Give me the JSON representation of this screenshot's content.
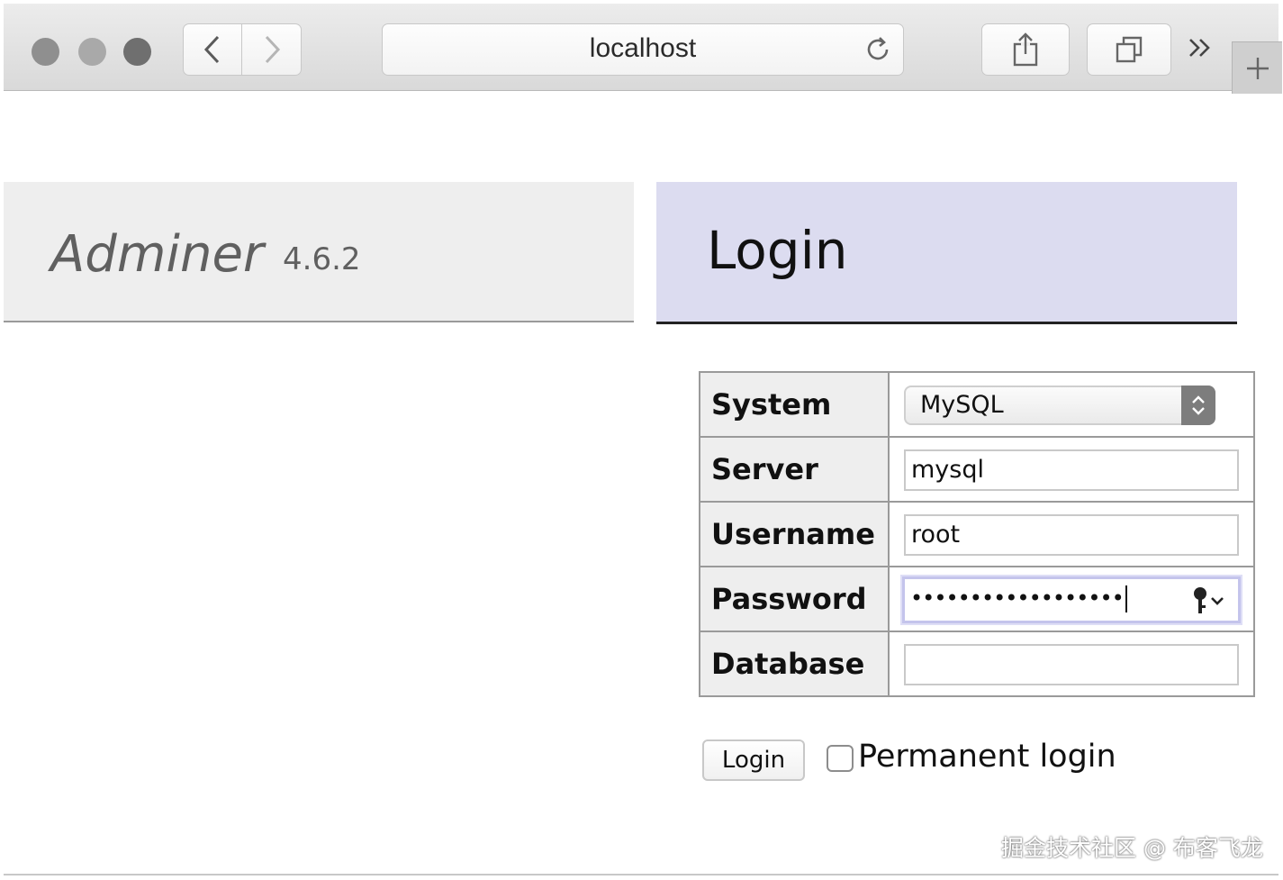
{
  "browser": {
    "url": "localhost",
    "window_dots": [
      "close",
      "minimize",
      "zoom"
    ],
    "icons": {
      "back": "chevron-left-icon",
      "forward": "chevron-right-icon",
      "reload": "reload-icon",
      "share": "share-icon",
      "tabs": "tab-overview-icon",
      "more": "double-chevron-right-icon",
      "new_tab": "plus-icon"
    },
    "more_label": "»",
    "new_tab_label": "+"
  },
  "header": {
    "brand": "Adminer",
    "version": "4.6.2",
    "title": "Login"
  },
  "form": {
    "fields": [
      {
        "label": "System",
        "type": "select",
        "value": "MySQL"
      },
      {
        "label": "Server",
        "type": "text",
        "value": "mysql"
      },
      {
        "label": "Username",
        "type": "text",
        "value": "root"
      },
      {
        "label": "Password",
        "type": "password",
        "value": "••••••••••••••••••"
      },
      {
        "label": "Database",
        "type": "text",
        "value": ""
      }
    ],
    "submit_label": "Login",
    "permanent_label": "Permanent login",
    "permanent_checked": false
  },
  "watermark": "掘金技术社区 @ 布客飞龙",
  "colors": {
    "header_left_bg": "#eeeeee",
    "header_right_bg": "#dcdcf0",
    "focus_ring": "#c4c4ec"
  }
}
